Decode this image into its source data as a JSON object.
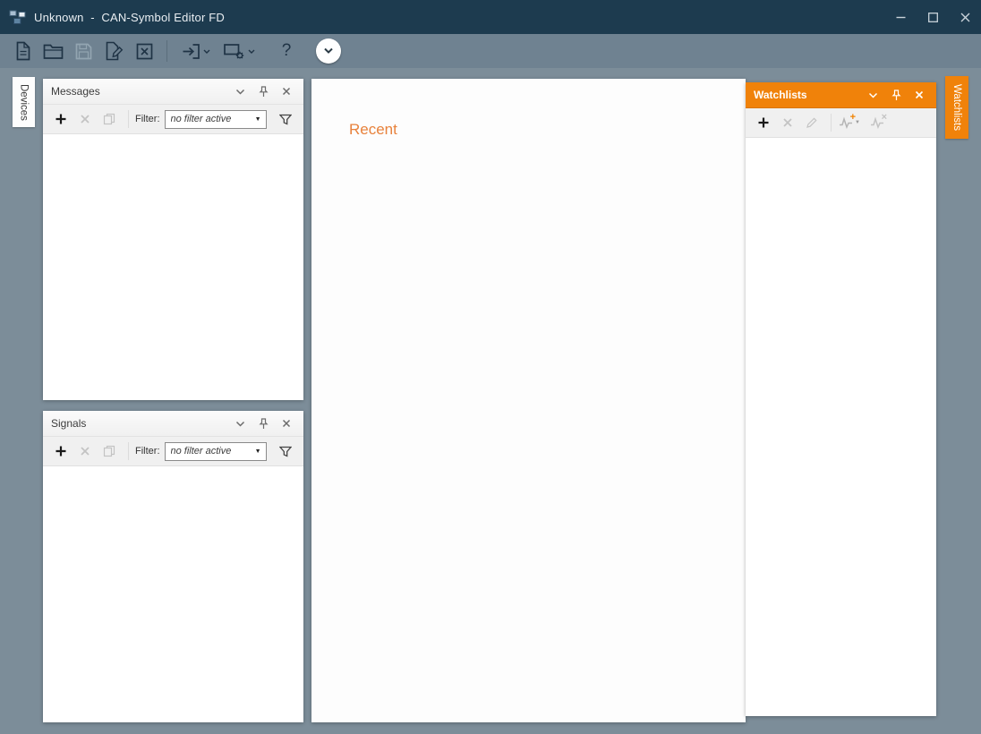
{
  "window": {
    "title": "Unknown  -  CAN-Symbol Editor FD"
  },
  "toolbar": {
    "help_label": "?",
    "items": [
      "new-file",
      "open-file",
      "save",
      "save-as",
      "close-file",
      "import",
      "export-device-settings",
      "help",
      "expand-toolbar"
    ]
  },
  "side_tabs": {
    "devices": "Devices",
    "watchlists": "Watchlists"
  },
  "messages_panel": {
    "title": "Messages",
    "filter_label": "Filter:",
    "filter_value": "no filter active",
    "toolbar_items": [
      "add-message",
      "delete-message",
      "copy-message",
      "filter-dropdown",
      "filter-toggle"
    ]
  },
  "signals_panel": {
    "title": "Signals",
    "filter_label": "Filter:",
    "filter_value": "no filter active",
    "toolbar_items": [
      "add-signal",
      "delete-signal",
      "copy-signal",
      "filter-dropdown",
      "filter-toggle"
    ]
  },
  "center_panel": {
    "heading": "Recent"
  },
  "watchlists_panel": {
    "title": "Watchlists",
    "toolbar_items": [
      "add-watchlist",
      "delete-watchlist",
      "edit-watchlist",
      "add-signal-to-watchlist",
      "remove-signal-from-watchlist"
    ]
  },
  "colors": {
    "titlebar": "#1d3b4f",
    "toolbar": "#6f8291",
    "workspace": "#7c8d99",
    "accent_orange": "#f0820a",
    "recent_text": "#e8823c"
  }
}
